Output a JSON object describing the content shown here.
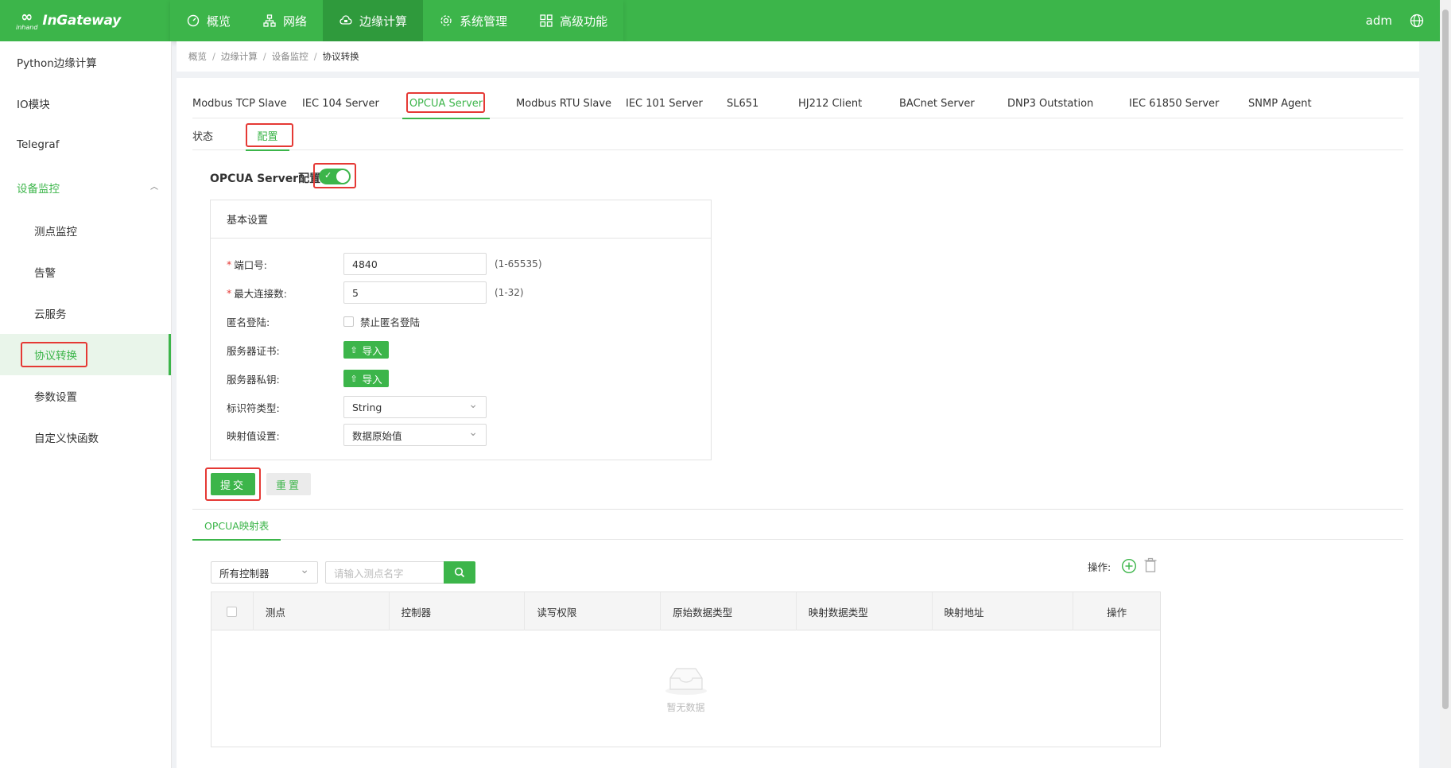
{
  "brand": {
    "name": "InGateway",
    "mark_small": "inhand"
  },
  "nav": [
    {
      "label": "概览",
      "icon": "dashboard-icon"
    },
    {
      "label": "网络",
      "icon": "network-icon"
    },
    {
      "label": "边缘计算",
      "icon": "cloud-compute-icon"
    },
    {
      "label": "系统管理",
      "icon": "gear-icon"
    },
    {
      "label": "高级功能",
      "icon": "grid-icon"
    }
  ],
  "user": {
    "name": "adm"
  },
  "sidebar": {
    "items": [
      {
        "label": "Python边缘计算"
      },
      {
        "label": "IO模块"
      },
      {
        "label": "Telegraf"
      }
    ],
    "group": {
      "label": "设备监控"
    },
    "sub_items": [
      {
        "label": "测点监控"
      },
      {
        "label": "告警"
      },
      {
        "label": "云服务"
      },
      {
        "label": "协议转换"
      },
      {
        "label": "参数设置"
      },
      {
        "label": "自定义快函数"
      }
    ]
  },
  "breadcrumb": [
    "概览",
    "边缘计算",
    "设备监控",
    "协议转换"
  ],
  "protocol_tabs": [
    "Modbus TCP Slave",
    "IEC 104 Server",
    "OPCUA Server",
    "Modbus RTU Slave",
    "IEC 101 Server",
    "SL651",
    "HJ212 Client",
    "BACnet Server",
    "DNP3 Outstation",
    "IEC 61850 Server",
    "SNMP Agent"
  ],
  "sub_tabs": [
    "状态",
    "配置"
  ],
  "config": {
    "title": "OPCUA Server配置",
    "enabled": true,
    "card_title": "基本设置",
    "port": {
      "label": "端口号:",
      "value": "4840",
      "hint": "(1-65535)"
    },
    "max_conn": {
      "label": "最大连接数:",
      "value": "5",
      "hint": "(1-32)"
    },
    "anon": {
      "label": "匿名登陆:",
      "checkbox_label": "禁止匿名登陆",
      "checked": false
    },
    "cert": {
      "label": "服务器证书:",
      "button": "导入"
    },
    "key": {
      "label": "服务器私钥:",
      "button": "导入"
    },
    "id_type": {
      "label": "标识符类型:",
      "value": "String"
    },
    "map_value": {
      "label": "映射值设置:",
      "value": "数据原始值"
    },
    "submit": "提交",
    "reset": "重置"
  },
  "mapping": {
    "tab": "OPCUA映射表",
    "controller_filter": "所有控制器",
    "search_placeholder": "请输入测点名字",
    "ops_label": "操作:",
    "columns": [
      "测点",
      "控制器",
      "读写权限",
      "原始数据类型",
      "映射数据类型",
      "映射地址",
      "操作"
    ],
    "empty_text": "暂无数据"
  },
  "colors": {
    "brand_green": "#3cb54a",
    "highlight_red": "#e53935"
  }
}
